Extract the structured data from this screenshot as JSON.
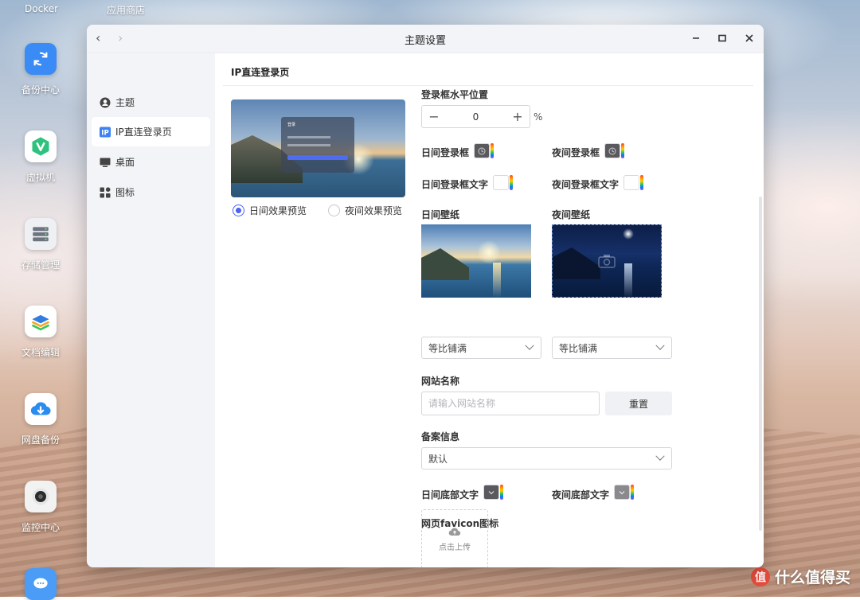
{
  "desktop": {
    "top_labels": [
      "Docker",
      "应用商店"
    ],
    "icons": [
      {
        "label": "备份中心",
        "icon": "sync-icon",
        "color": "#3a8bf5"
      },
      {
        "label": "虚拟机",
        "icon": "v-icon",
        "color": "#ffffff"
      },
      {
        "label": "存储管理",
        "icon": "storage-icon",
        "color": "#eef0f3"
      },
      {
        "label": "文档编辑",
        "icon": "layers-icon",
        "color": "#ffffff"
      },
      {
        "label": "网盘备份",
        "icon": "cloud-download-icon",
        "color": "#ffffff"
      },
      {
        "label": "监控中心",
        "icon": "camera-icon",
        "color": "#f2f2f2"
      }
    ],
    "watermark": {
      "glyph": "值",
      "text": "什么值得买"
    }
  },
  "window": {
    "title": "主题设置",
    "nav_back": "‹",
    "nav_forward": "›"
  },
  "sidebar": {
    "items": [
      {
        "label": "主题",
        "icon": "user-circle-icon"
      },
      {
        "label": "IP直连登录页",
        "icon": "ip-badge-icon",
        "active": true
      },
      {
        "label": "桌面",
        "icon": "monitor-icon"
      },
      {
        "label": "图标",
        "icon": "grid-icon"
      }
    ]
  },
  "content": {
    "section_title": "IP直连登录页",
    "preview": {
      "panel_title": "登录",
      "day_radio": "日间效果预览",
      "night_radio": "夜间效果预览",
      "selected": "day"
    },
    "horizontal_position": {
      "label": "登录框水平位置",
      "value": "0",
      "unit": "%",
      "minus": "−",
      "plus": "+"
    },
    "day_login_box": {
      "label": "日间登录框"
    },
    "night_login_box": {
      "label": "夜间登录框"
    },
    "day_login_text": {
      "label": "日间登录框文字"
    },
    "night_login_text": {
      "label": "夜间登录框文字"
    },
    "day_wallpaper": {
      "label": "日间壁纸",
      "fit": "等比铺满"
    },
    "night_wallpaper": {
      "label": "夜间壁纸",
      "fit": "等比铺满"
    },
    "site_name": {
      "label": "网站名称",
      "placeholder": "请输入网站名称",
      "reset": "重置"
    },
    "record_info": {
      "label": "备案信息",
      "value": "默认"
    },
    "day_footer_text": {
      "label": "日间底部文字"
    },
    "night_footer_text": {
      "label": "夜间底部文字"
    },
    "favicon": {
      "label": "网页favicon图标",
      "upload": "点击上传"
    }
  },
  "colors": {
    "accent": "#4a62f2",
    "dark_swatch": "#5a5a5e",
    "sidebar_bg": "#f3f4f7"
  }
}
